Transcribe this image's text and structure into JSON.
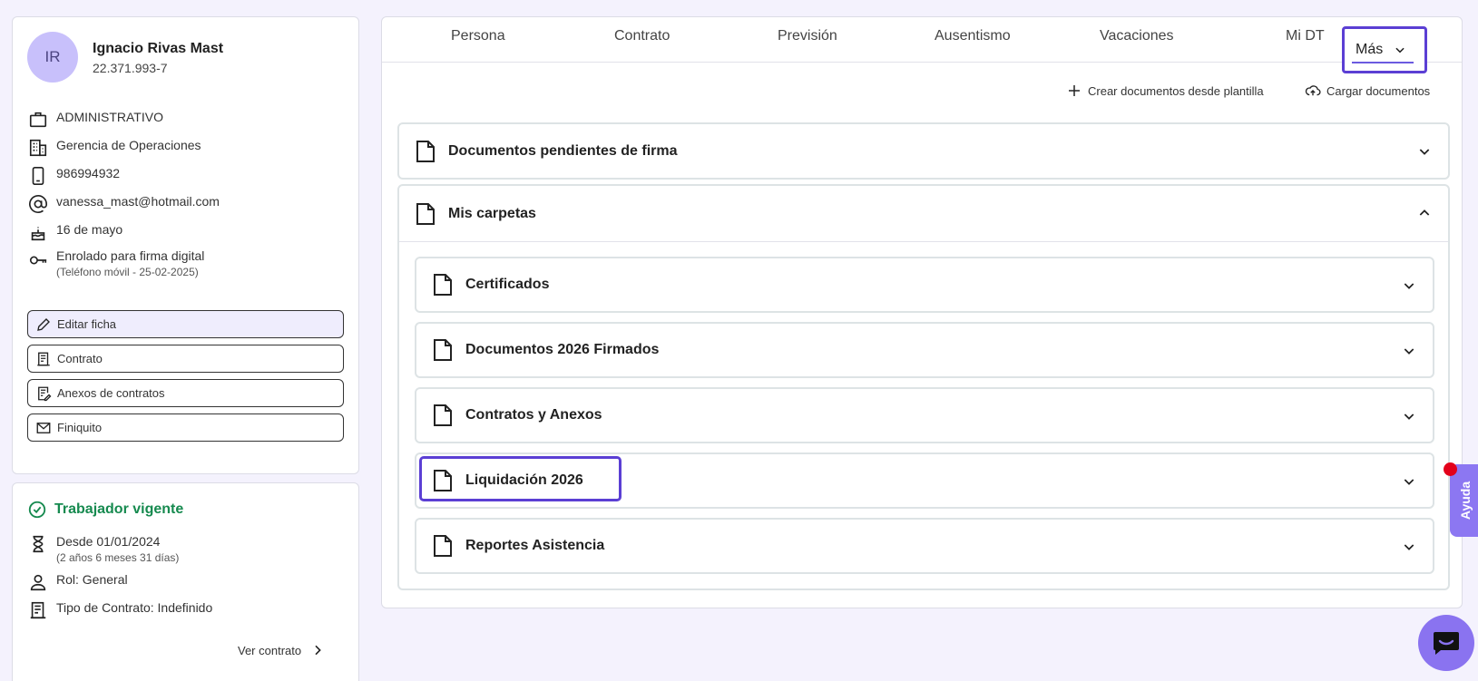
{
  "profile": {
    "initials": "IR",
    "name": "Ignacio Rivas Mast",
    "rut": "22.371.993-7",
    "info": {
      "position": "ADMINISTRATIVO",
      "department": "Gerencia de Operaciones",
      "phone": "986994932",
      "email": "vanessa_mast@hotmail.com",
      "birthday": "16 de mayo",
      "signature": "Enrolado para firma digital",
      "signature_detail": "(Teléfono móvil - 25-02-2025)"
    },
    "buttons": {
      "edit": "Editar ficha",
      "contract": "Contrato",
      "annexes": "Anexos de contratos",
      "settlement": "Finiquito"
    }
  },
  "status": {
    "title": "Trabajador vigente",
    "since": "Desde 01/01/2024",
    "since_detail": "(2 años 6 meses 31 días)",
    "role": "Rol: General",
    "contract_type": "Tipo de Contrato: Indefinido",
    "view_contract": "Ver contrato"
  },
  "tabs": [
    "Persona",
    "Contrato",
    "Previsión",
    "Ausentismo",
    "Vacaciones",
    "Mi DT"
  ],
  "tab_more": "Más",
  "actions": {
    "create": "Crear documentos desde plantilla",
    "upload": "Cargar documentos"
  },
  "sections": {
    "pending": "Documentos pendientes de firma",
    "folders": "Mis carpetas"
  },
  "folders": [
    "Certificados",
    "Documentos 2026 Firmados",
    "Contratos y Anexos",
    "Liquidación 2026",
    "Reportes Asistencia"
  ],
  "help_label": "Ayuda",
  "colors": {
    "accent": "#5b3fd4",
    "success": "#168a4f",
    "help": "#8c77f2",
    "notification": "#e3001b"
  }
}
